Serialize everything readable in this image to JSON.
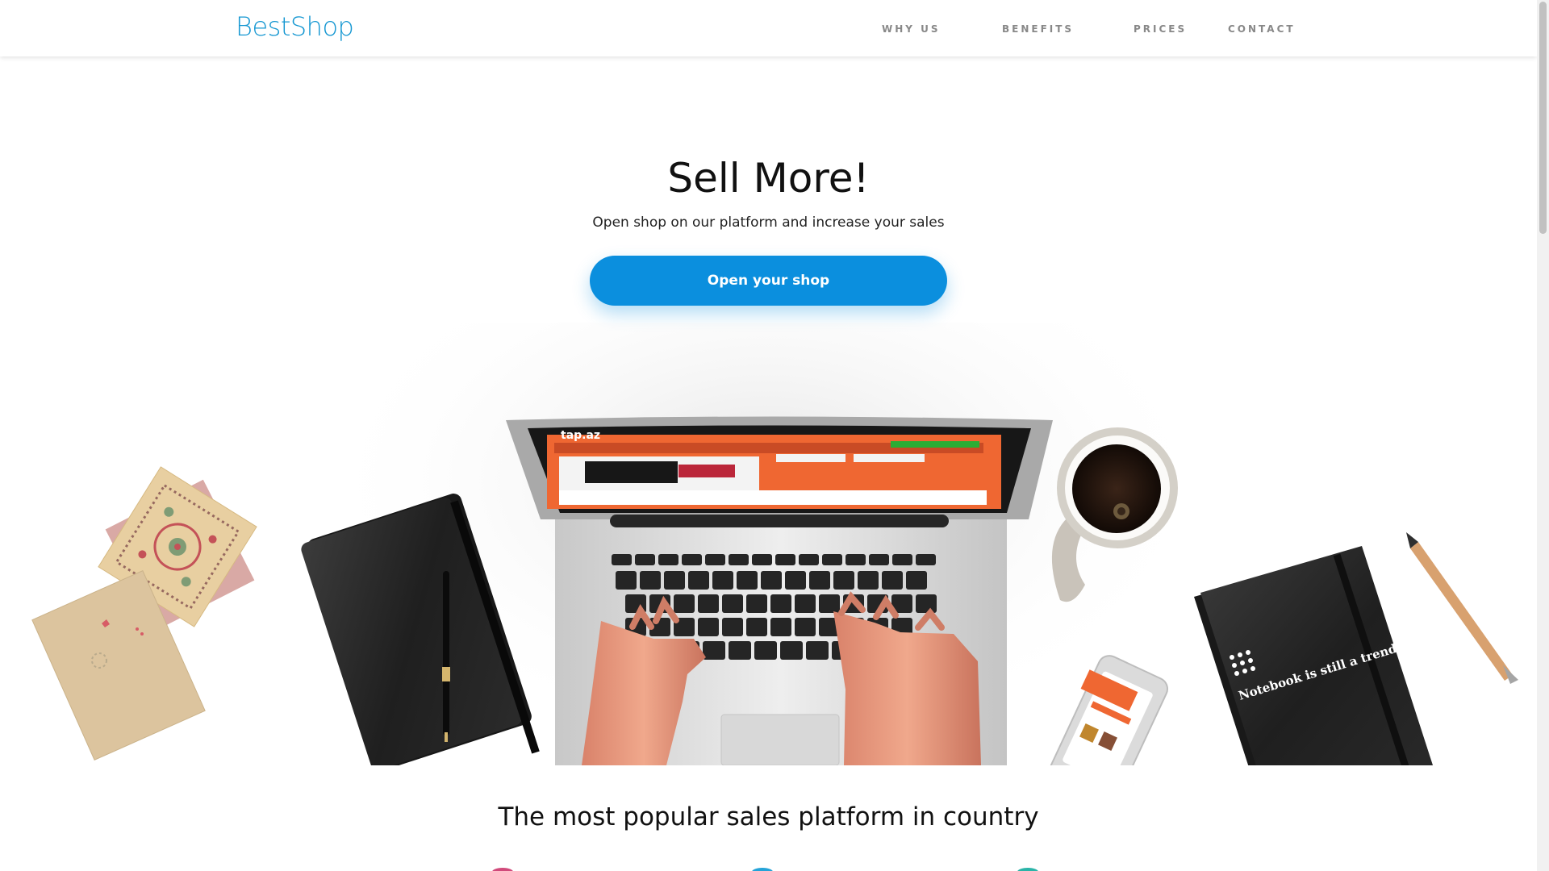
{
  "brand": {
    "logo": "BestShop"
  },
  "nav": [
    "WHY US",
    "BENEFITS",
    "PRICES",
    "CONTACT"
  ],
  "hero": {
    "title": "Sell More!",
    "subtitle": "Open shop on our platform and increase your sales",
    "cta": "Open your shop"
  },
  "scene": {
    "notebook_text": "Notebook is still a trend",
    "laptop_brand_text": "tap.az"
  },
  "section": {
    "title": "The most popular sales platform in country"
  },
  "colors": {
    "brand": "#1597d2",
    "cta": "#0b8fde",
    "nav_text": "#888888",
    "site_accent": "#f26a32"
  }
}
